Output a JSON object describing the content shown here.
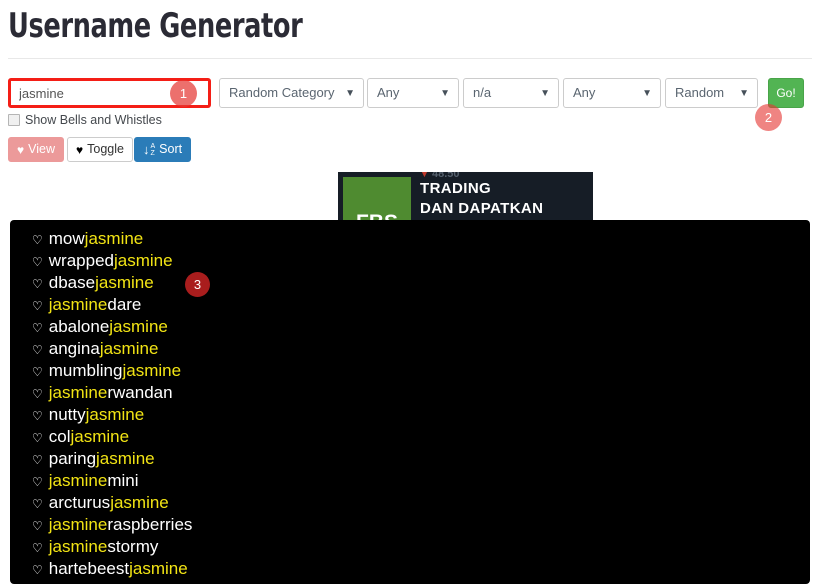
{
  "page": {
    "title": "Username Generator"
  },
  "form": {
    "name_input": {
      "value": "jasmine",
      "placeholder": ""
    },
    "selects": [
      {
        "name": "category",
        "value": "Random Category"
      },
      {
        "name": "length",
        "value": "Any"
      },
      {
        "name": "numbers",
        "value": "n/a"
      },
      {
        "name": "style",
        "value": "Any"
      },
      {
        "name": "order",
        "value": "Random"
      }
    ],
    "caret": "▼",
    "go_label": "Go!",
    "checkbox": {
      "label": "Show Bells and Whistles",
      "checked": false
    }
  },
  "toolbar": {
    "view_label": "View",
    "toggle_label": "Toggle",
    "sort_label": "Sort",
    "heart_icon": "♥",
    "sort_arrow": "↓",
    "sort_a": "A",
    "sort_z": "Z"
  },
  "ad": {
    "logo_text": "FBS",
    "line1": "TRADING",
    "line2": "DAN DAPATKAN PROFIT",
    "ticker_triangle": "▼",
    "ticker_value": "48.50"
  },
  "results": {
    "bullet_icon": "♡",
    "items": [
      {
        "pre": "mow",
        "hl": "jasmine",
        "post": ""
      },
      {
        "pre": "wrapped",
        "hl": "jasmine",
        "post": ""
      },
      {
        "pre": "dbase",
        "hl": "jasmine",
        "post": ""
      },
      {
        "pre": "",
        "hl": "jasmine",
        "post": "dare"
      },
      {
        "pre": "abalone",
        "hl": "jasmine",
        "post": ""
      },
      {
        "pre": "angina",
        "hl": "jasmine",
        "post": ""
      },
      {
        "pre": "mumbling",
        "hl": "jasmine",
        "post": ""
      },
      {
        "pre": "",
        "hl": "jasmine",
        "post": "rwandan"
      },
      {
        "pre": "nutty",
        "hl": "jasmine",
        "post": ""
      },
      {
        "pre": "col",
        "hl": "jasmine",
        "post": ""
      },
      {
        "pre": "paring",
        "hl": "jasmine",
        "post": ""
      },
      {
        "pre": "",
        "hl": "jasmine",
        "post": "mini"
      },
      {
        "pre": "arcturus",
        "hl": "jasmine",
        "post": ""
      },
      {
        "pre": "",
        "hl": "jasmine",
        "post": "raspberries"
      },
      {
        "pre": "",
        "hl": "jasmine",
        "post": "stormy"
      },
      {
        "pre": "hartebeest",
        "hl": "jasmine",
        "post": ""
      }
    ]
  },
  "annotations": {
    "badge1": "1",
    "badge2": "2",
    "badge3": "3"
  },
  "colors": {
    "highlight_border": "#f41e16",
    "go_green": "#52b453",
    "view_pink": "#ec9a9a",
    "sort_blue": "#2b7cb8",
    "result_highlight": "#f2e414",
    "badge_red": "#a91d1d",
    "panel_black": "#000000"
  }
}
